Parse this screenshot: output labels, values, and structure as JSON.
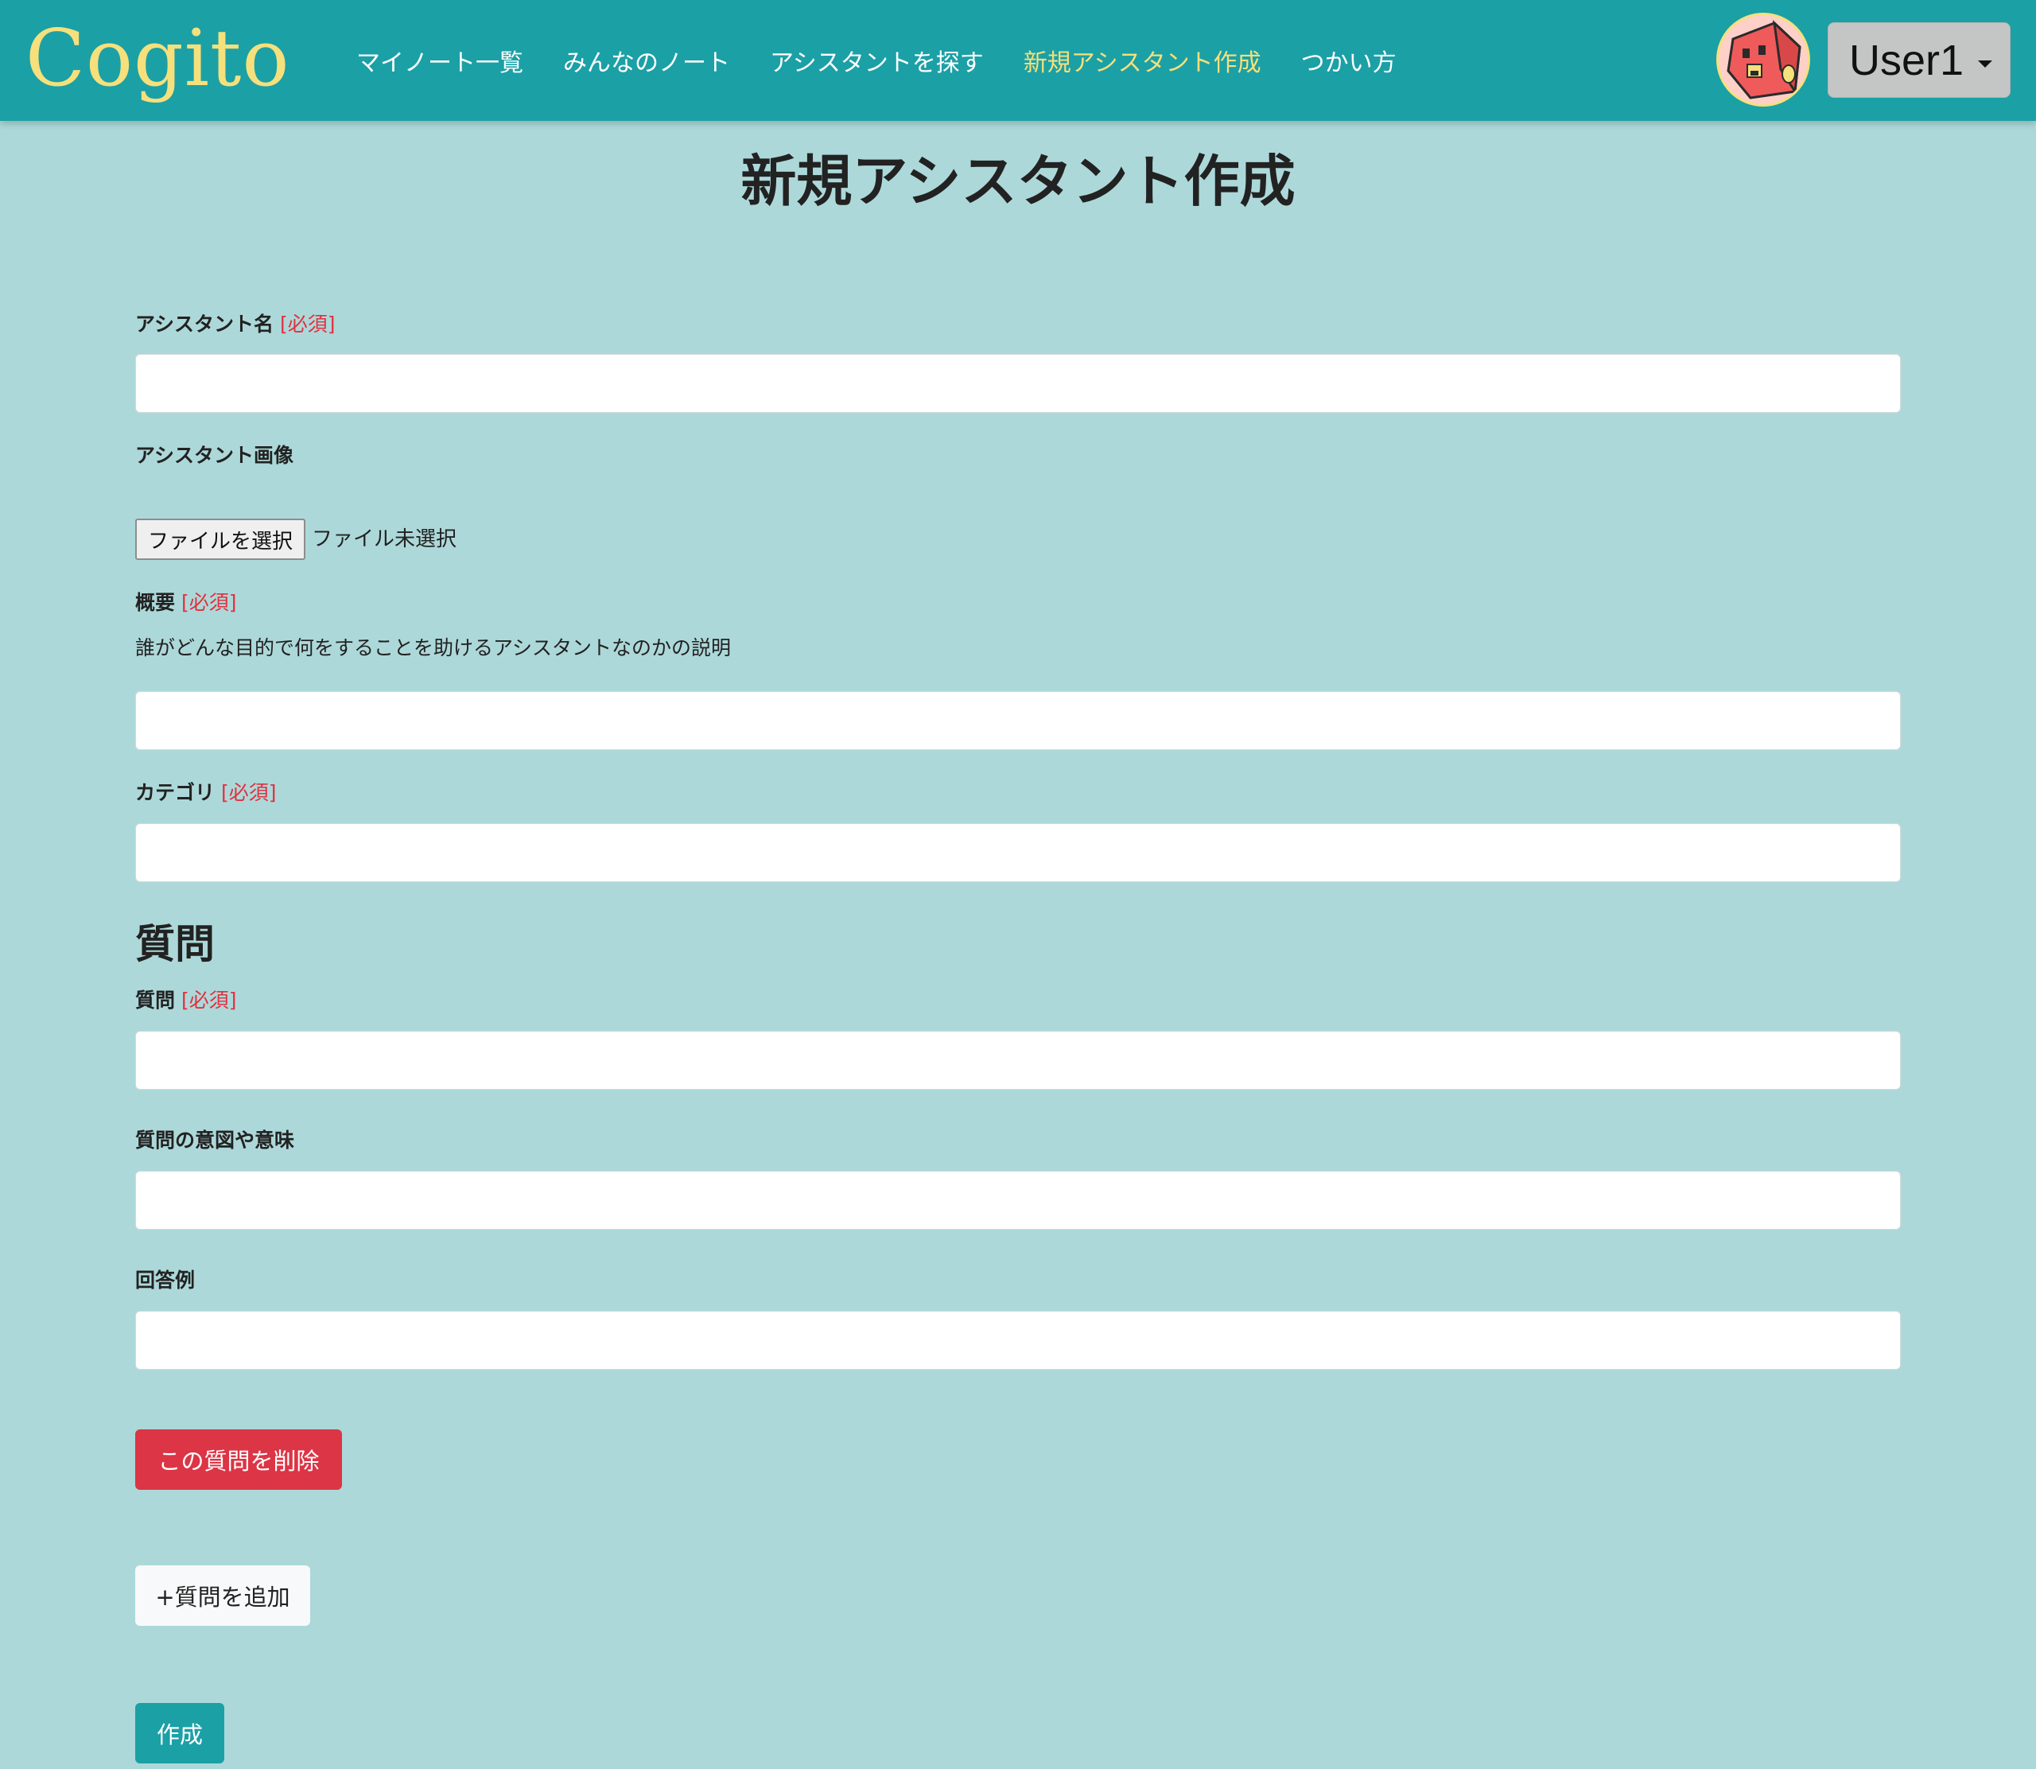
{
  "header": {
    "brand": "Cogito",
    "nav": [
      {
        "label": "マイノート一覧"
      },
      {
        "label": "みんなのノート"
      },
      {
        "label": "アシスタントを探す"
      },
      {
        "label": "新規アシスタント作成",
        "active": true
      },
      {
        "label": "つかい方"
      }
    ],
    "user_label": "User1",
    "avatar_icon": "red-cube-character-avatar"
  },
  "page": {
    "title": "新規アシスタント作成"
  },
  "form": {
    "required_tag": "[必須]",
    "name": {
      "label": "アシスタント名",
      "value": ""
    },
    "image": {
      "label": "アシスタント画像",
      "button": "ファイルを選択",
      "status": "ファイル未選択"
    },
    "summary": {
      "label": "概要",
      "help": "誰がどんな目的で何をすることを助けるアシスタントなのかの説明",
      "value": ""
    },
    "category": {
      "label": "カテゴリ",
      "value": ""
    },
    "questions_heading": "質問",
    "question": {
      "label": "質問",
      "value": ""
    },
    "intent": {
      "label": "質問の意図や意味",
      "value": ""
    },
    "example": {
      "label": "回答例",
      "value": ""
    },
    "delete_button": "この質問を削除",
    "add_button": "+質問を追加",
    "create_button": "作成"
  },
  "colors": {
    "header_bg": "#1ba0a6",
    "page_bg": "#add8d9",
    "brand": "#f5e07c",
    "active_nav": "#f5e07c",
    "required": "#e0303f",
    "delete_button": "#dc3545",
    "create_button": "#1ba0a6"
  }
}
